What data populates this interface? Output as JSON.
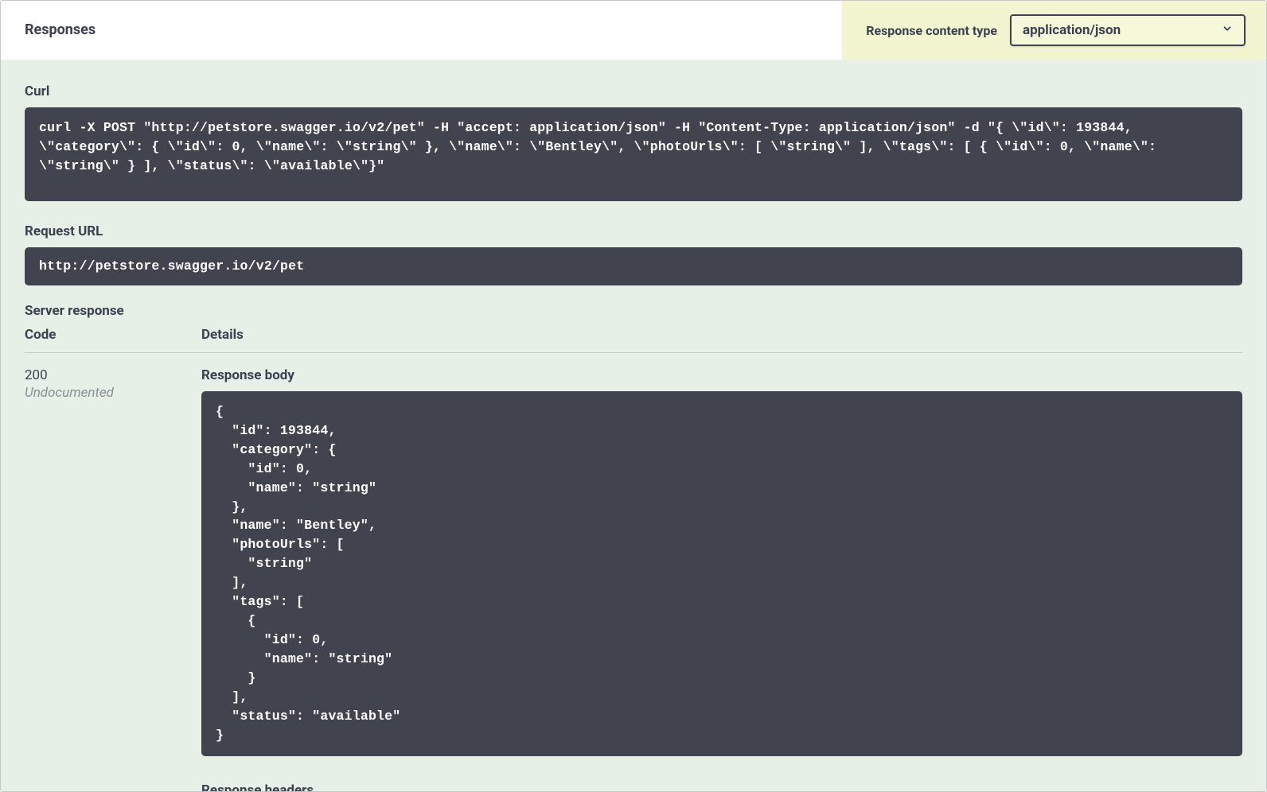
{
  "header": {
    "title": "Responses",
    "content_type_label": "Response content type",
    "content_type_value": "application/json"
  },
  "sections": {
    "curl_label": "Curl",
    "curl_value": "curl -X POST \"http://petstore.swagger.io/v2/pet\" -H \"accept: application/json\" -H \"Content-Type: application/json\" -d \"{ \\\"id\\\": 193844, \\\"category\\\": { \\\"id\\\": 0, \\\"name\\\": \\\"string\\\" }, \\\"name\\\": \\\"Bentley\\\", \\\"photoUrls\\\": [ \\\"string\\\" ], \\\"tags\\\": [ { \\\"id\\\": 0, \\\"name\\\": \\\"string\\\" } ], \\\"status\\\": \\\"available\\\"}\"",
    "request_url_label": "Request URL",
    "request_url_value": "http://petstore.swagger.io/v2/pet",
    "server_response_label": "Server response",
    "table": {
      "code_header": "Code",
      "details_header": "Details"
    },
    "row0": {
      "code": "200",
      "note": "Undocumented",
      "response_body_label": "Response body",
      "response_body_value": "{\n  \"id\": 193844,\n  \"category\": {\n    \"id\": 0,\n    \"name\": \"string\"\n  },\n  \"name\": \"Bentley\",\n  \"photoUrls\": [\n    \"string\"\n  ],\n  \"tags\": [\n    {\n      \"id\": 0,\n      \"name\": \"string\"\n    }\n  ],\n  \"status\": \"available\"\n}",
      "response_headers_label": "Response headers"
    }
  }
}
